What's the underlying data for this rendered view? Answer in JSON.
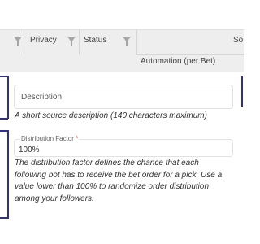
{
  "table_header": {
    "columns": [
      {
        "label": "Privacy",
        "filter_icon": "filter-icon"
      },
      {
        "label": "Status",
        "filter_icon": "filter-icon"
      },
      {
        "label": "So"
      }
    ],
    "subheader": "Automation (per Bet)"
  },
  "description_field": {
    "placeholder": "Description",
    "helper": "A short source description (140 characters maximum)"
  },
  "distribution_field": {
    "label": "Distribution Factor",
    "required_mark": "*",
    "value": "100%",
    "helper": "The distribution factor defines the chance that each following bot has to receive the bet order for a pick. Use a value lower than 100% to randomize order distribution among your followers."
  },
  "colors": {
    "accent": "#2f2f8f",
    "header_bg": "#eeeeee",
    "required": "#d32f2f"
  }
}
